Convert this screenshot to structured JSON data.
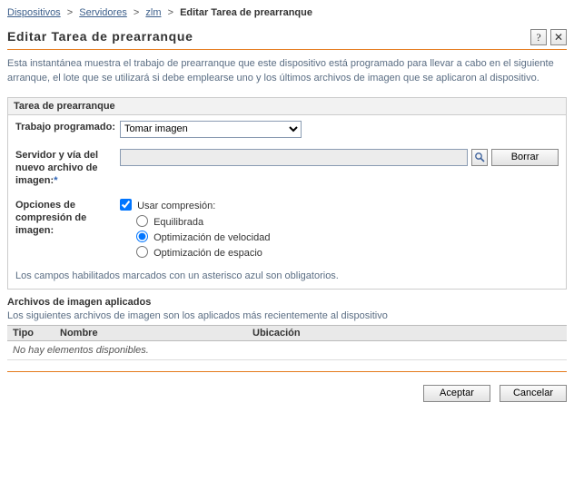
{
  "breadcrumb": {
    "items": [
      "Dispositivos",
      "Servidores",
      "zlm"
    ],
    "current": "Editar Tarea de prearranque"
  },
  "title": "Editar Tarea de prearranque",
  "intro": "Esta instantánea muestra el trabajo de prearranque que este dispositivo está programado para llevar a cabo en el siguiente arranque, el lote que se utilizará si debe emplearse uno y los últimos archivos de imagen que se aplicaron al dispositivo.",
  "panel": {
    "legend": "Tarea de prearranque",
    "job_label": "Trabajo programado:",
    "job_value": "Tomar imagen",
    "path_label": "Servidor y vía del nuevo archivo de imagen:",
    "clear_btn": "Borrar",
    "compress_label": "Opciones de compresión de imagen:",
    "use_compress": "Usar compresión:",
    "opt_balanced": "Equilibrada",
    "opt_speed": "Optimización de velocidad",
    "opt_space": "Optimización de espacio",
    "note": "Los campos habilitados marcados con un asterisco azul son obligatorios."
  },
  "applied": {
    "title": "Archivos de imagen aplicados",
    "desc": "Los siguientes archivos de imagen son los aplicados más recientemente al dispositivo",
    "col_type": "Tipo",
    "col_name": "Nombre",
    "col_loc": "Ubicación",
    "empty": "No hay elementos disponibles."
  },
  "footer": {
    "ok": "Aceptar",
    "cancel": "Cancelar"
  }
}
